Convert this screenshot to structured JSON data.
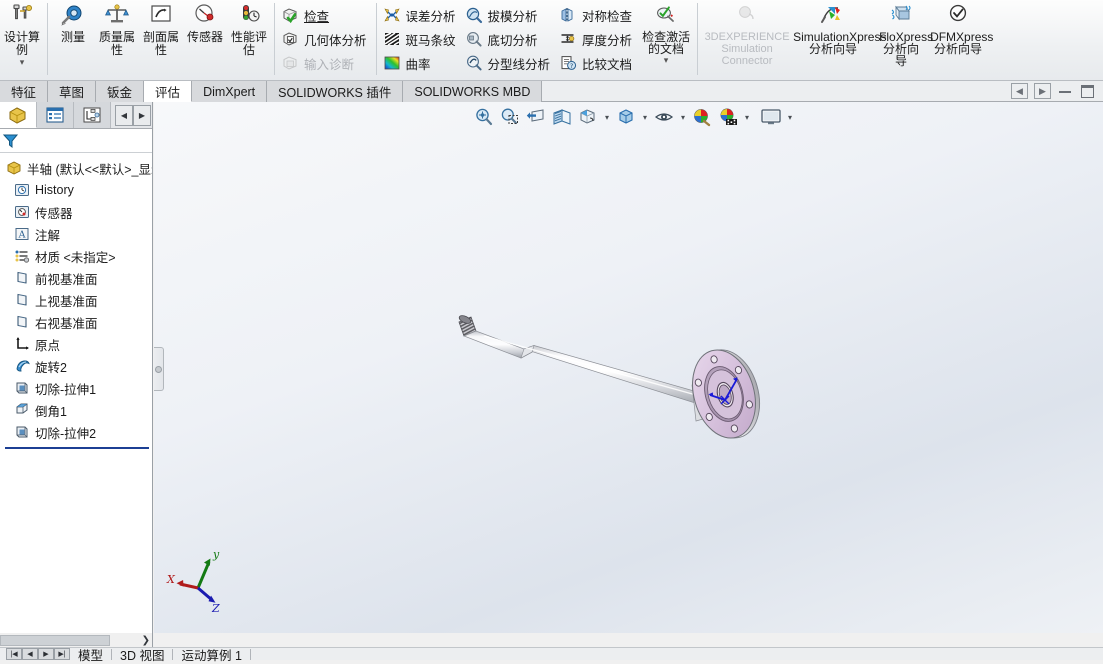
{
  "ribbon": {
    "design_study": {
      "label": "设计算例",
      "icon": "design-study-icon"
    },
    "eval_tools": [
      {
        "label": "测量",
        "icon": "measure-icon"
      },
      {
        "label": "质量属性",
        "icon": "mass-properties-icon"
      },
      {
        "label": "剖面属性",
        "icon": "section-properties-icon"
      },
      {
        "label": "传感器",
        "icon": "sensor-icon"
      },
      {
        "label": "性能评估",
        "icon": "performance-evaluation-icon"
      }
    ],
    "check_col": [
      {
        "label": "检查",
        "icon": "check-icon",
        "disabled": false,
        "underline": true
      },
      {
        "label": "几何体分析",
        "icon": "geometry-analysis-icon",
        "disabled": false
      },
      {
        "label": "输入诊断",
        "icon": "import-diagnostics-icon",
        "disabled": true
      }
    ],
    "analysis_col_a": [
      {
        "label": "误差分析",
        "icon": "deviation-analysis-icon",
        "disabled": false
      },
      {
        "label": "斑马条纹",
        "icon": "zebra-stripes-icon",
        "disabled": false
      },
      {
        "label": "曲率",
        "icon": "curvature-icon",
        "disabled": false
      }
    ],
    "analysis_col_b": [
      {
        "label": "拔模分析",
        "icon": "draft-analysis-icon",
        "disabled": false
      },
      {
        "label": "底切分析",
        "icon": "undercut-analysis-icon",
        "disabled": false
      },
      {
        "label": "分型线分析",
        "icon": "parting-line-analysis-icon",
        "disabled": false
      }
    ],
    "analysis_col_c": [
      {
        "label": "对称检查",
        "icon": "symmetry-check-icon",
        "disabled": false
      },
      {
        "label": "厚度分析",
        "icon": "thickness-analysis-icon",
        "disabled": false
      },
      {
        "label": "比较文档",
        "icon": "compare-documents-icon",
        "disabled": false
      }
    ],
    "check_active_doc": {
      "label": "检查激活的文档",
      "icon": "check-active-document-icon"
    },
    "wizards": [
      {
        "label": "3DEXPERIENCE Simulation Connector",
        "icon": "3dexperience-simulation-connector-icon",
        "disabled": true
      },
      {
        "label": "SimulationXpress 分析向导",
        "icon": "simulationxpress-icon",
        "disabled": false
      },
      {
        "label": "FloXpress 分析向导",
        "icon": "floxpress-icon",
        "disabled": false
      },
      {
        "label": "DFMXpress 分析向导",
        "icon": "dfmxpress-icon",
        "disabled": false
      }
    ]
  },
  "tabs": [
    {
      "label": "特征",
      "active": false
    },
    {
      "label": "草图",
      "active": false
    },
    {
      "label": "钣金",
      "active": false
    },
    {
      "label": "评估",
      "active": true
    },
    {
      "label": "DimXpert",
      "active": false
    },
    {
      "label": "SOLIDWORKS 插件",
      "active": false
    },
    {
      "label": "SOLIDWORKS MBD",
      "active": false
    }
  ],
  "window_controls": {
    "prev_doc": "prev-document-icon",
    "next_doc": "next-document-icon",
    "minimize": "minimize-icon",
    "restore": "restore-icon"
  },
  "left_panel": {
    "tabs": [
      {
        "name": "feature-manager-tab",
        "icon": "feature-tree-icon",
        "active": true
      },
      {
        "name": "property-manager-tab",
        "icon": "property-manager-icon",
        "active": false
      },
      {
        "name": "configuration-manager-tab",
        "icon": "configuration-manager-icon",
        "active": false
      }
    ],
    "nav": {
      "back": "◀",
      "forward": "▶"
    },
    "filter_icon": "filter-icon",
    "root": {
      "label": "半轴  (默认<<默认>_显示",
      "icon": "part-icon"
    },
    "tree": [
      {
        "label": "History",
        "icon": "history-icon"
      },
      {
        "label": "传感器",
        "icon": "sensors-icon"
      },
      {
        "label": "注解",
        "icon": "annotations-icon"
      },
      {
        "label": "材质 <未指定>",
        "icon": "material-icon"
      },
      {
        "label": "前视基准面",
        "icon": "plane-icon"
      },
      {
        "label": "上视基准面",
        "icon": "plane-icon"
      },
      {
        "label": "右视基准面",
        "icon": "plane-icon"
      },
      {
        "label": "原点",
        "icon": "origin-icon"
      },
      {
        "label": "旋转2",
        "icon": "revolve-icon"
      },
      {
        "label": "切除-拉伸1",
        "icon": "cut-extrude-icon"
      },
      {
        "label": "倒角1",
        "icon": "chamfer-icon"
      },
      {
        "label": "切除-拉伸2",
        "icon": "cut-extrude-icon"
      }
    ]
  },
  "view_toolbar": [
    {
      "name": "zoom-to-fit-button",
      "icon": "zoom-to-fit-icon",
      "caret": false
    },
    {
      "name": "zoom-to-area-button",
      "icon": "zoom-to-area-icon",
      "caret": false
    },
    {
      "name": "previous-view-button",
      "icon": "previous-view-icon",
      "caret": false
    },
    {
      "name": "section-view-button",
      "icon": "section-view-icon",
      "caret": false
    },
    {
      "name": "view-orientation-button",
      "icon": "view-orientation-icon",
      "caret": false
    },
    {
      "name": "display-style-button",
      "icon": "display-style-icon",
      "caret": true
    },
    {
      "name": "hide-show-items-button",
      "icon": "hide-show-items-icon",
      "caret": true
    },
    {
      "name": "edit-appearance-button",
      "icon": "edit-appearance-icon",
      "caret": false
    },
    {
      "name": "apply-scene-button",
      "icon": "apply-scene-icon",
      "caret": true
    },
    {
      "name": "view-settings-button",
      "icon": "view-settings-icon",
      "caret": true
    }
  ],
  "model": {
    "name": "axle-shaft-3d-model",
    "triad": {
      "x_label": "X",
      "y_label": "y",
      "z_label": "Z",
      "x_color": "#b01b1b",
      "y_color": "#137a13",
      "z_color": "#1b1bb0"
    },
    "flange_color": "#d9c4dd",
    "shaft_color": "#f2f2f4"
  },
  "status_bar": {
    "nav_buttons": [
      "|◀",
      "◀",
      "▶",
      "▶|"
    ],
    "tabs": [
      {
        "label": "模型",
        "active": true
      },
      {
        "label": "3D 视图",
        "active": false
      },
      {
        "label": "运动算例 1",
        "active": false
      }
    ]
  },
  "scrollbar": {
    "arrow": "❯"
  },
  "colors": {
    "ribbon_bg": "#eef0f2",
    "accent_blue": "#17375e",
    "tab_active": "#ffffff",
    "viewport_top": "#f7f8fa",
    "viewport_mid": "#dde3ec"
  }
}
